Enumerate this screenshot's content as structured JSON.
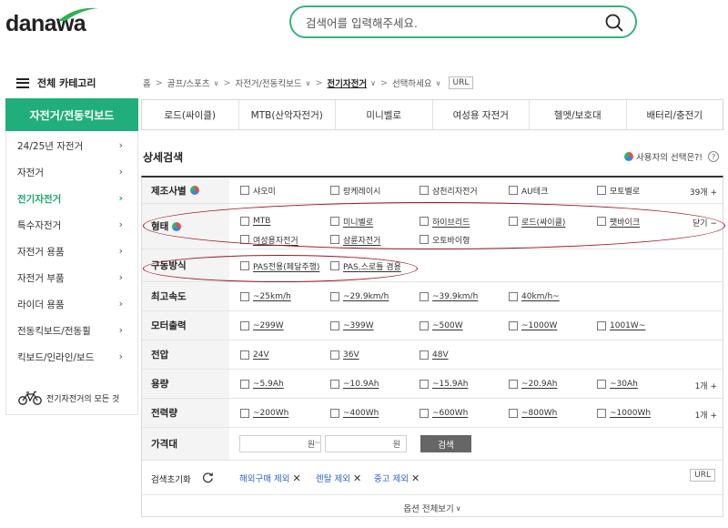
{
  "header": {
    "logo": "danawa",
    "search_placeholder": "검색어를 입력해주세요."
  },
  "sidebar": {
    "header": "전체 카테고리",
    "active": "자전거/전동킥보드",
    "items": [
      {
        "label": "24/25년 자전거",
        "active": false
      },
      {
        "label": "자전거",
        "active": false
      },
      {
        "label": "전기자전거",
        "active": true
      },
      {
        "label": "특수자전거",
        "active": false
      },
      {
        "label": "자전거 용품",
        "active": false
      },
      {
        "label": "자전거 부품",
        "active": false
      },
      {
        "label": "라이더 용품",
        "active": false
      },
      {
        "label": "전동킥보드/전동휠",
        "active": false
      },
      {
        "label": "킥보드/인라인/보드",
        "active": false
      }
    ],
    "footer": "전기자전거의 모든 것"
  },
  "breadcrumb": {
    "items": [
      "홈",
      "골프/스포츠",
      "자전거/전동킥보드",
      "전기자전거",
      "선택하세요"
    ],
    "url_label": "URL"
  },
  "tabs": [
    "로드(싸이클)",
    "MTB(산악자전거)",
    "미니벨로",
    "여성용 자전거",
    "헬멧/보호대",
    "배터리/충전기"
  ],
  "detail": {
    "title": "상세검색",
    "choice_label": "사용자의 선택은?!",
    "help": "?"
  },
  "filters": {
    "maker": {
      "label": "제조사별",
      "options": [
        "샤오미",
        "랑케레이시",
        "삼천리자전거",
        "AU테크",
        "모토벨로"
      ],
      "more": "39개 +"
    },
    "shape": {
      "label": "형태",
      "options": [
        "MTB",
        "미니벨로",
        "하이브리드",
        "로드(싸이클)",
        "팻바이크",
        "여성용자전거",
        "삼륜자전거",
        "오토바이형"
      ],
      "more": "닫기 −"
    },
    "drive": {
      "label": "구동방식",
      "options": [
        "PAS전용(페달주행)",
        "PAS,스로틀 겸용"
      ]
    },
    "speed": {
      "label": "최고속도",
      "options": [
        "~25km/h",
        "~29.9km/h",
        "~39.9km/h",
        "40km/h~"
      ]
    },
    "motor": {
      "label": "모터출력",
      "options": [
        "~299W",
        "~399W",
        "~500W",
        "~1000W",
        "1001W~"
      ]
    },
    "voltage": {
      "label": "전압",
      "options": [
        "24V",
        "36V",
        "48V"
      ]
    },
    "capacity": {
      "label": "용량",
      "options": [
        "~5.9Ah",
        "~10.9Ah",
        "~15.9Ah",
        "~20.9Ah",
        "~30Ah"
      ],
      "more": "1개 +"
    },
    "energy": {
      "label": "전력량",
      "options": [
        "~200Wh",
        "~400Wh",
        "~600Wh",
        "~800Wh",
        "~1000Wh"
      ],
      "more": "1개 +"
    },
    "price": {
      "label": "가격대",
      "unit": "원",
      "tilde": "~",
      "button": "검색"
    }
  },
  "reset": {
    "label": "검색초기화",
    "reset_icon": "refresh-icon",
    "excludes": [
      "해외구매 제외",
      "렌탈 제외",
      "중고 제외"
    ],
    "url_label": "URL"
  },
  "more_toggle": "옵션 전체보기",
  "colors": {
    "accent": "#1fae7c",
    "highlight": "#9b1522",
    "link": "#2a64c9"
  }
}
